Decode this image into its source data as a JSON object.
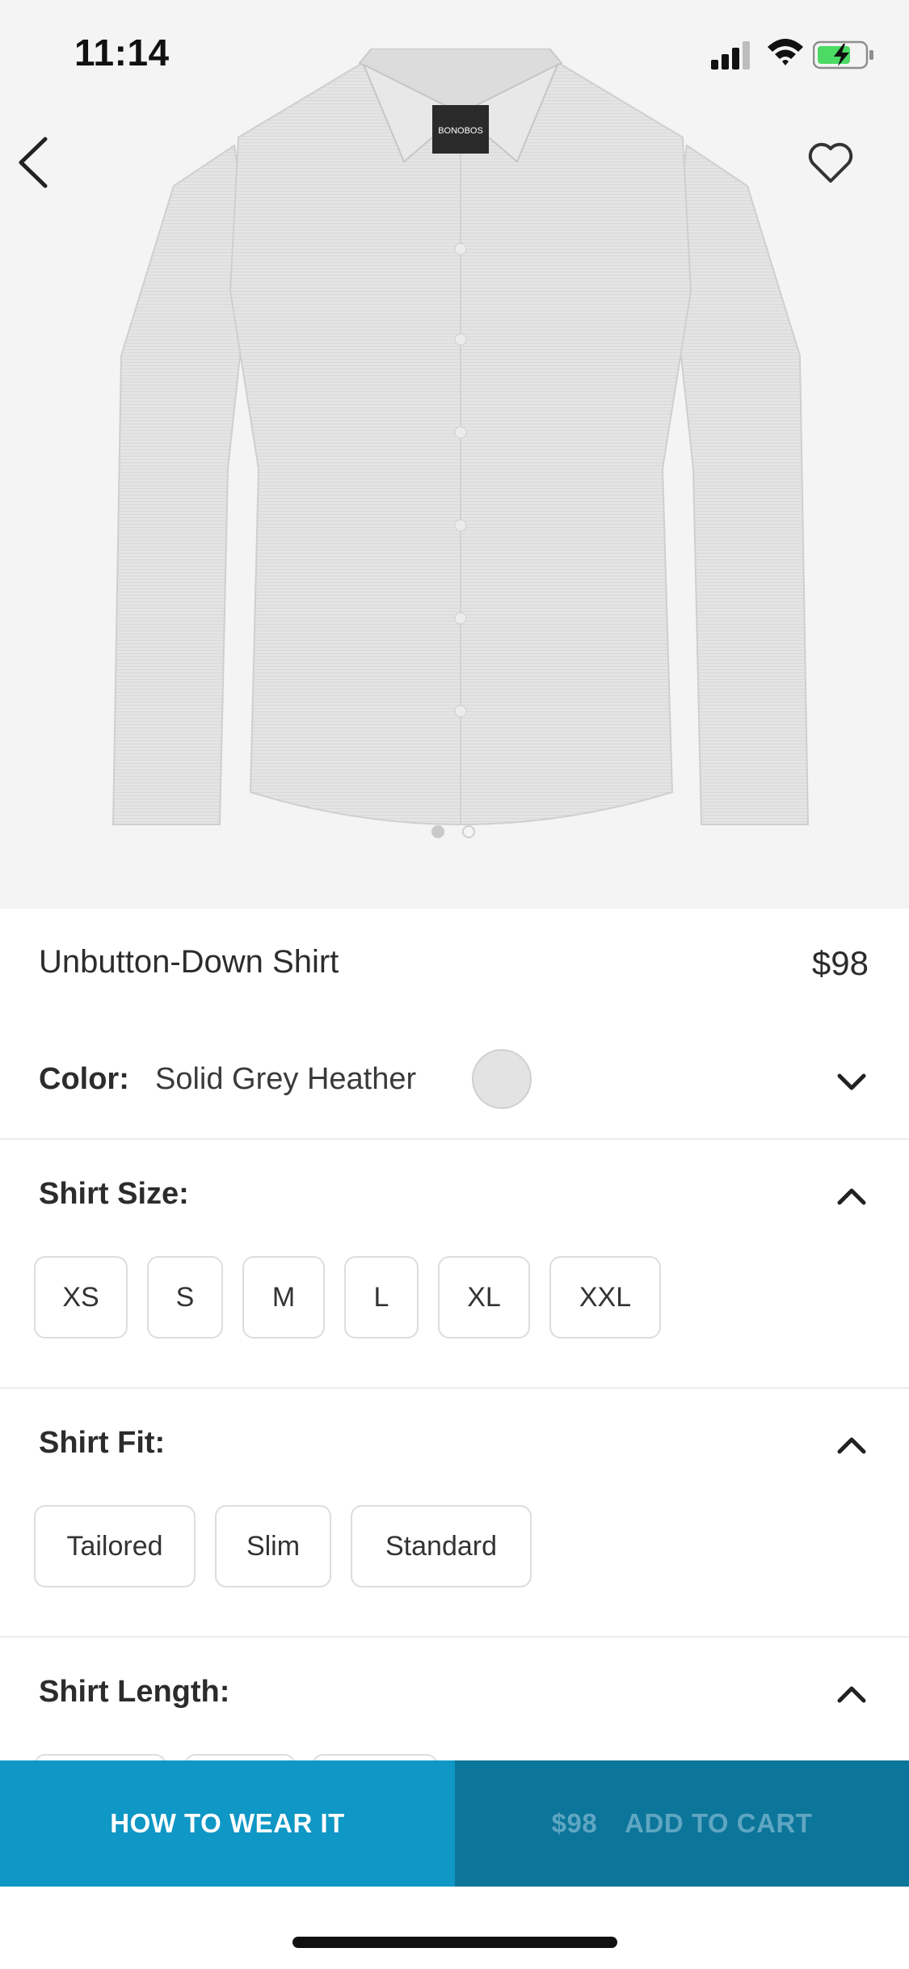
{
  "status": {
    "time": "11:14"
  },
  "product": {
    "name": "Unbutton-Down Shirt",
    "price": "$98",
    "brand_label": "BONOBOS",
    "image_icon": "shirt-image",
    "carousel_pages": 2
  },
  "color": {
    "label": "Color:",
    "value": "Solid Grey Heather",
    "swatch": "#e3e3e3"
  },
  "shirt_size": {
    "title": "Shirt Size:",
    "options": [
      "XS",
      "S",
      "M",
      "L",
      "XL",
      "XXL"
    ]
  },
  "shirt_fit": {
    "title": "Shirt Fit:",
    "options": [
      "Tailored",
      "Slim",
      "Standard"
    ]
  },
  "shirt_length": {
    "title": "Shirt Length:"
  },
  "actions": {
    "how_to_wear": "HOW TO WEAR IT",
    "cart_price": "$98",
    "add_to_cart": "ADD TO CART"
  },
  "colors": {
    "primary_button": "#0f97c5",
    "secondary_button": "#0c759a",
    "battery": "#4cd964"
  }
}
